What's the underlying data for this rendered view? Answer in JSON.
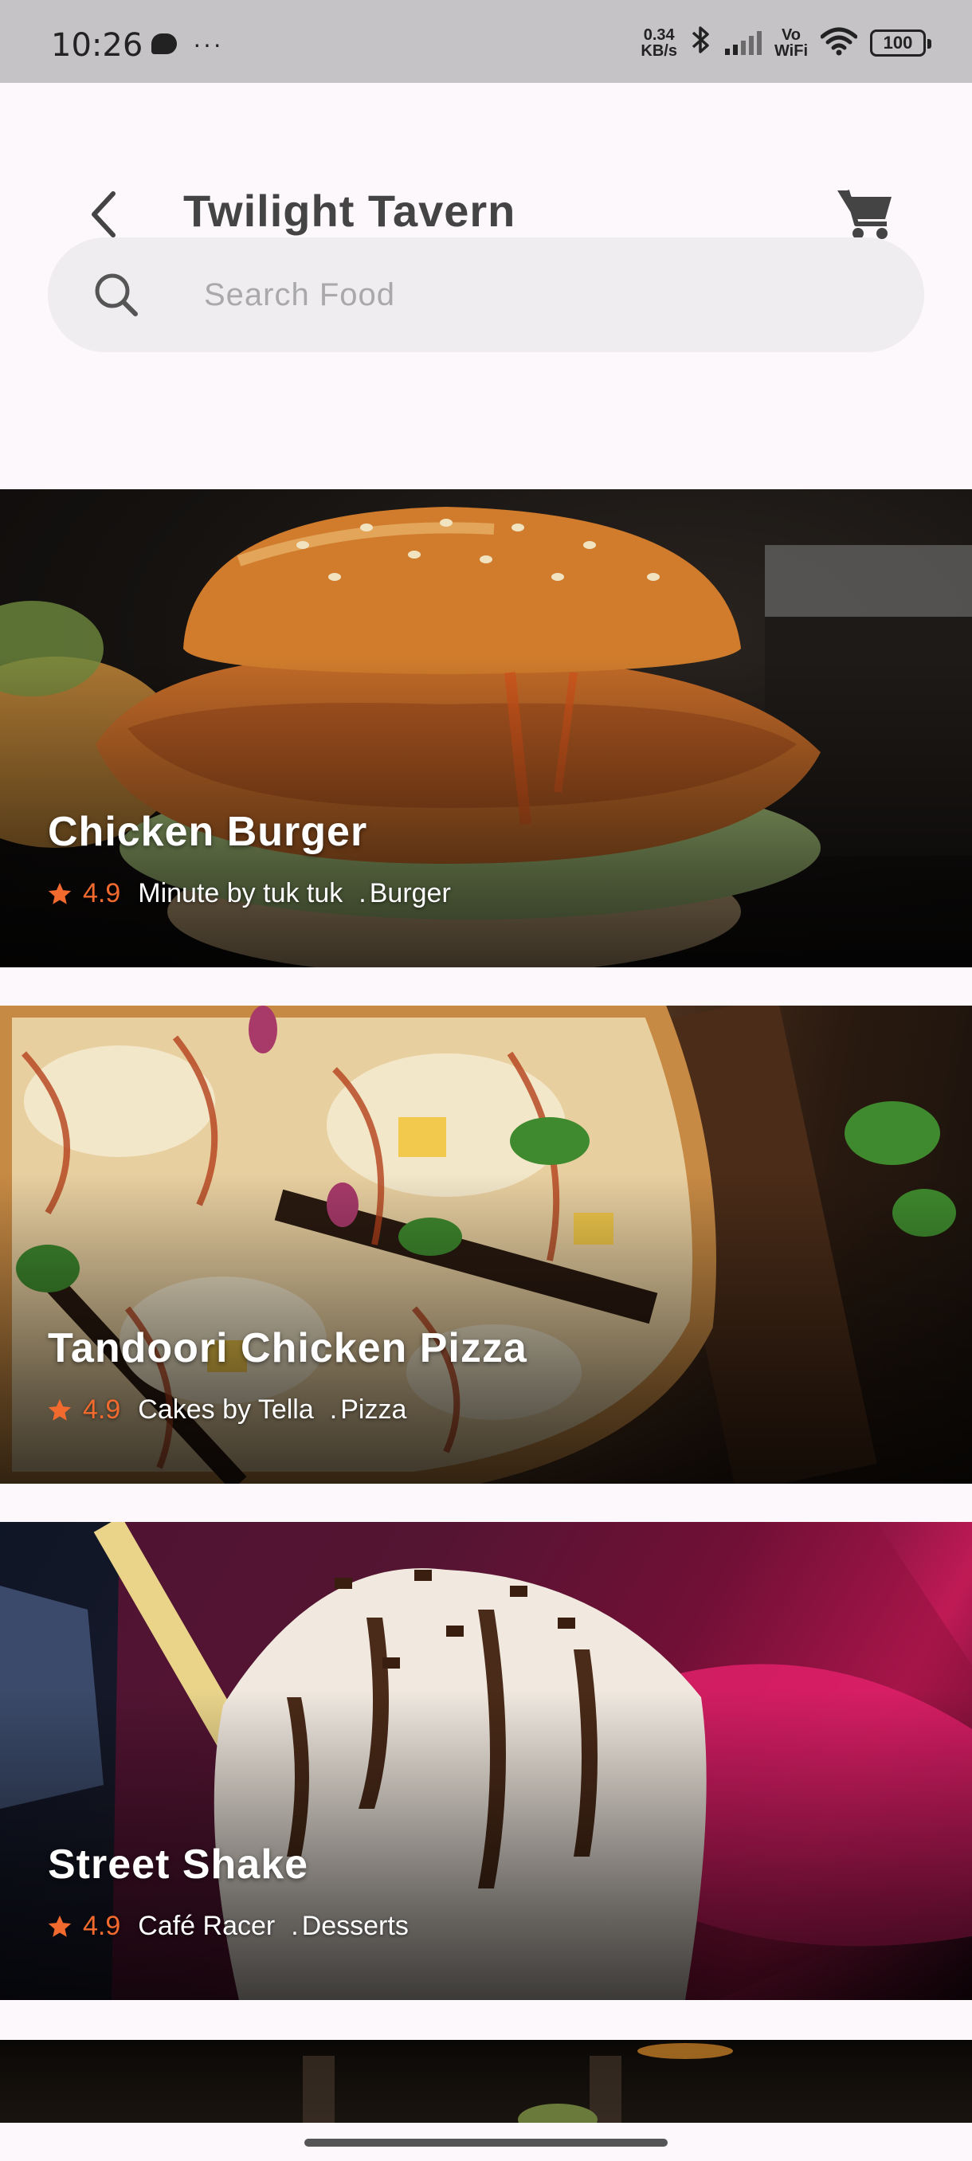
{
  "status_bar": {
    "time": "10:26",
    "network_speed_top": "0.34",
    "network_speed_bottom": "KB/s",
    "vowifi_top": "Vo",
    "vowifi_bottom": "WiFi",
    "battery": "100",
    "icons": [
      "message-icon",
      "more-dots-icon",
      "bluetooth-icon",
      "signal-icon",
      "wifi-icon",
      "battery-icon"
    ]
  },
  "header": {
    "title": "Twilight Tavern",
    "back_icon": "chevron-left-icon",
    "cart_icon": "cart-icon"
  },
  "search": {
    "placeholder": "Search Food",
    "icon": "search-icon"
  },
  "colors": {
    "accent": "#f26a2e",
    "title": "#444444",
    "background": "#fcf8fc",
    "search_bg": "#efedef"
  },
  "items": [
    {
      "name": "Chicken Burger",
      "rating": "4.9",
      "restaurant": "Minute by tuk tuk",
      "category_separator": ".",
      "category": "Burger"
    },
    {
      "name": "Tandoori Chicken Pizza",
      "rating": "4.9",
      "restaurant": "Cakes by Tella",
      "category_separator": ".",
      "category": "Pizza"
    },
    {
      "name": "Street Shake",
      "rating": "4.9",
      "restaurant": "Café Racer",
      "category_separator": ".",
      "category": "Desserts"
    }
  ]
}
